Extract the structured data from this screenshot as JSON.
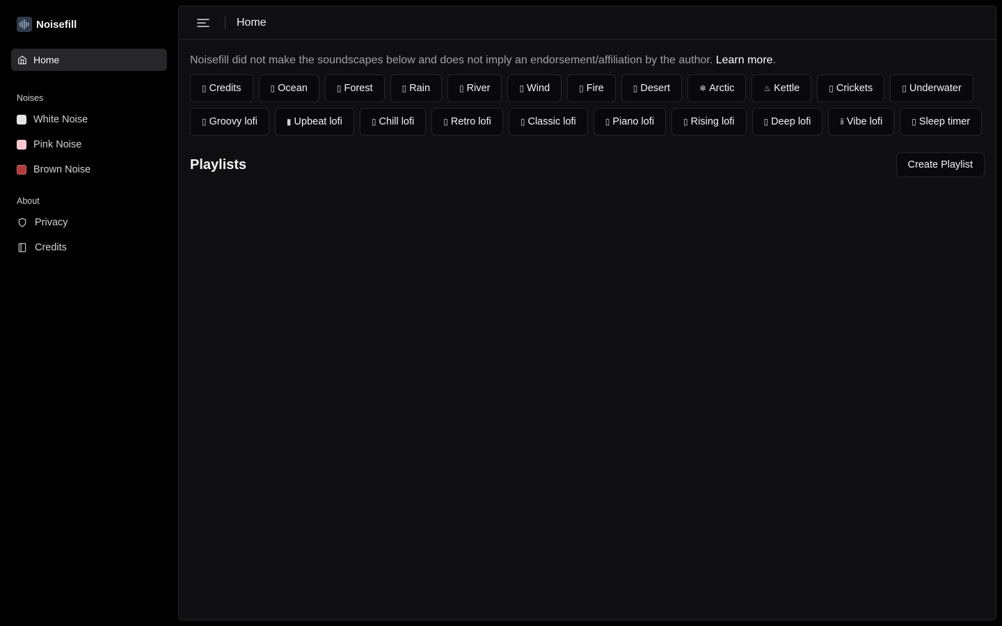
{
  "app": {
    "name": "Noisefill"
  },
  "sidebar": {
    "home": {
      "label": "Home",
      "icon": "home-icon"
    },
    "noises_label": "Noises",
    "noises": [
      {
        "label": "White Noise",
        "color": "#e4e4e7"
      },
      {
        "label": "Pink Noise",
        "color": "#f9c6cf"
      },
      {
        "label": "Brown Noise",
        "color": "#b23a3a"
      }
    ],
    "about_label": "About",
    "about": [
      {
        "label": "Privacy",
        "icon": "shield-icon"
      },
      {
        "label": "Credits",
        "icon": "book-icon"
      }
    ]
  },
  "header": {
    "title": "Home",
    "menu_icon": "menu-icon"
  },
  "main": {
    "disclaimer": "Noisefill did not make the soundscapes below and does not imply an endorsement/affiliation by the author.",
    "learn_more": "Learn more",
    "learn_more_suffix": ".",
    "soundscapes": [
      {
        "label": "Credits",
        "emoji": "▯"
      },
      {
        "label": "Ocean",
        "emoji": "▯"
      },
      {
        "label": "Forest",
        "emoji": "▯"
      },
      {
        "label": "Rain",
        "emoji": "▯"
      },
      {
        "label": "River",
        "emoji": "▯"
      },
      {
        "label": "Wind",
        "emoji": "▯"
      },
      {
        "label": "Fire",
        "emoji": "▯"
      },
      {
        "label": "Desert",
        "emoji": "▯"
      },
      {
        "label": "Arctic",
        "emoji": "❄"
      },
      {
        "label": "Kettle",
        "emoji": "♨"
      },
      {
        "label": "Crickets",
        "emoji": "▯"
      },
      {
        "label": "Underwater",
        "emoji": "▯"
      },
      {
        "label": "Groovy lofi",
        "emoji": "▯"
      },
      {
        "label": "Upbeat lofi",
        "emoji": "▮"
      },
      {
        "label": "Chill lofi",
        "emoji": "▯"
      },
      {
        "label": "Retro lofi",
        "emoji": "▯"
      },
      {
        "label": "Classic lofi",
        "emoji": "▯"
      },
      {
        "label": "Piano lofi",
        "emoji": "▯"
      },
      {
        "label": "Rising lofi",
        "emoji": "▯"
      },
      {
        "label": "Deep lofi",
        "emoji": "▯"
      },
      {
        "label": "Vibe lofi",
        "emoji": "ⅱ"
      },
      {
        "label": "Sleep timer",
        "emoji": "▯"
      }
    ],
    "playlists_title": "Playlists",
    "create_playlist": "Create Playlist"
  }
}
